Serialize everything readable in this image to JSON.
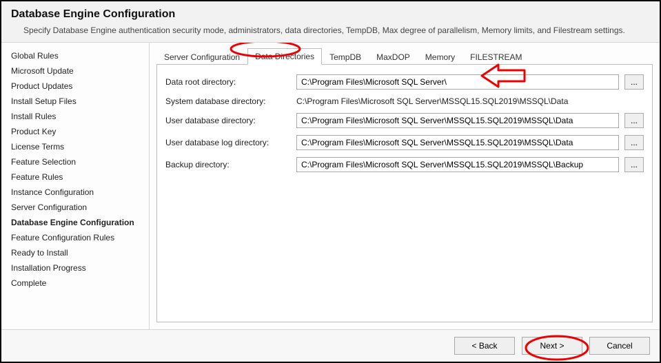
{
  "header": {
    "title": "Database Engine Configuration",
    "subtitle": "Specify Database Engine authentication security mode, administrators, data directories, TempDB, Max degree of parallelism, Memory limits, and Filestream settings."
  },
  "sidebar": {
    "items": [
      {
        "label": "Global Rules"
      },
      {
        "label": "Microsoft Update"
      },
      {
        "label": "Product Updates"
      },
      {
        "label": "Install Setup Files"
      },
      {
        "label": "Install Rules"
      },
      {
        "label": "Product Key"
      },
      {
        "label": "License Terms"
      },
      {
        "label": "Feature Selection"
      },
      {
        "label": "Feature Rules"
      },
      {
        "label": "Instance Configuration"
      },
      {
        "label": "Server Configuration"
      },
      {
        "label": "Database Engine Configuration",
        "current": true
      },
      {
        "label": "Feature Configuration Rules"
      },
      {
        "label": "Ready to Install"
      },
      {
        "label": "Installation Progress"
      },
      {
        "label": "Complete"
      }
    ]
  },
  "tabs": [
    {
      "label": "Server Configuration"
    },
    {
      "label": "Data Directories",
      "active": true
    },
    {
      "label": "TempDB"
    },
    {
      "label": "MaxDOP"
    },
    {
      "label": "Memory"
    },
    {
      "label": "FILESTREAM"
    }
  ],
  "form": {
    "data_root_label": "Data root directory:",
    "data_root_value": "C:\\Program Files\\Microsoft SQL Server\\",
    "system_db_label": "System database directory:",
    "system_db_value": "C:\\Program Files\\Microsoft SQL Server\\MSSQL15.SQL2019\\MSSQL\\Data",
    "user_db_label": "User database directory:",
    "user_db_value": "C:\\Program Files\\Microsoft SQL Server\\MSSQL15.SQL2019\\MSSQL\\Data",
    "user_log_label": "User database log directory:",
    "user_log_value": "C:\\Program Files\\Microsoft SQL Server\\MSSQL15.SQL2019\\MSSQL\\Data",
    "backup_label": "Backup directory:",
    "backup_value": "C:\\Program Files\\Microsoft SQL Server\\MSSQL15.SQL2019\\MSSQL\\Backup",
    "browse_label": "..."
  },
  "footer": {
    "back": "< Back",
    "next": "Next >",
    "cancel": "Cancel"
  }
}
